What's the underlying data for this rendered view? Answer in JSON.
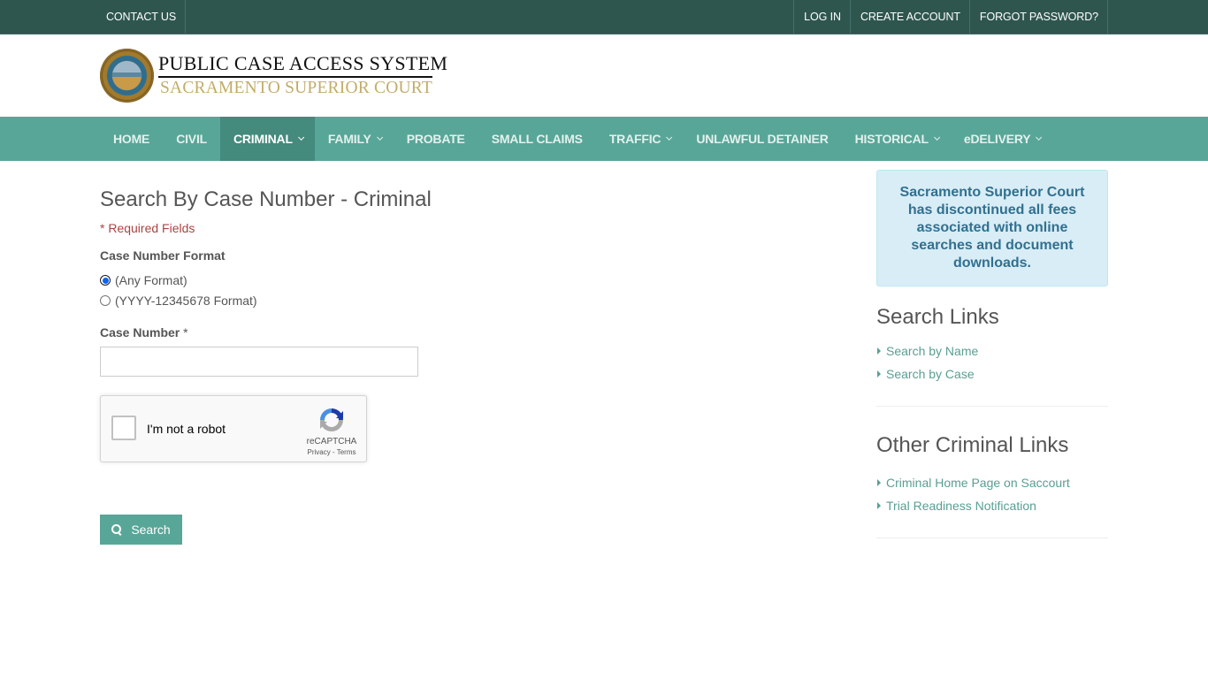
{
  "topbar": {
    "left_links": [
      "CONTACT US"
    ],
    "right_links": [
      "LOG IN",
      "CREATE ACCOUNT",
      "FORGOT PASSWORD?"
    ]
  },
  "header": {
    "title": "PUBLIC CASE ACCESS SYSTEM",
    "subtitle": "SACRAMENTO SUPERIOR COURT",
    "seal_icon": "court-seal-icon"
  },
  "nav": {
    "items": [
      {
        "label": "HOME",
        "dropdown": false,
        "active": false
      },
      {
        "label": "CIVIL",
        "dropdown": false,
        "active": false
      },
      {
        "label": "CRIMINAL",
        "dropdown": true,
        "active": true
      },
      {
        "label": "FAMILY",
        "dropdown": true,
        "active": false
      },
      {
        "label": "PROBATE",
        "dropdown": false,
        "active": false
      },
      {
        "label": "SMALL CLAIMS",
        "dropdown": false,
        "active": false
      },
      {
        "label": "TRAFFIC",
        "dropdown": true,
        "active": false
      },
      {
        "label": "UNLAWFUL DETAINER",
        "dropdown": false,
        "active": false
      },
      {
        "label": "HISTORICAL",
        "dropdown": true,
        "active": false
      },
      {
        "label": "eDELIVERY",
        "dropdown": true,
        "active": false
      }
    ]
  },
  "main": {
    "title": "Search By Case Number - Criminal",
    "required_note": "* Required Fields",
    "format_label": "Case Number Format",
    "format_options": [
      {
        "label": "(Any Format)",
        "checked": true
      },
      {
        "label": "(YYYY-12345678 Format)",
        "checked": false
      }
    ],
    "case_number_label": "Case Number",
    "case_number_required": "*",
    "case_number_value": "",
    "captcha": {
      "label": "I'm not a robot",
      "brand": "reCAPTCHA",
      "terms": "Privacy - Terms"
    },
    "search_button": "Search"
  },
  "sidebar": {
    "notice": "Sacramento Superior Court has discontinued all fees associated with online searches and document downloads.",
    "search_links_title": "Search Links",
    "search_links": [
      "Search by Name",
      "Search by Case"
    ],
    "other_links_title": "Other Criminal Links",
    "other_links": [
      "Criminal Home Page on Saccourt",
      "Trial Readiness Notification"
    ]
  },
  "colors": {
    "topbar": "#2e564f",
    "nav": "#58a698",
    "nav_active": "#448a7d",
    "link": "#5a9e93",
    "required": "#a94442",
    "notice_bg": "#d9edf7",
    "notice_text": "#31708f"
  }
}
